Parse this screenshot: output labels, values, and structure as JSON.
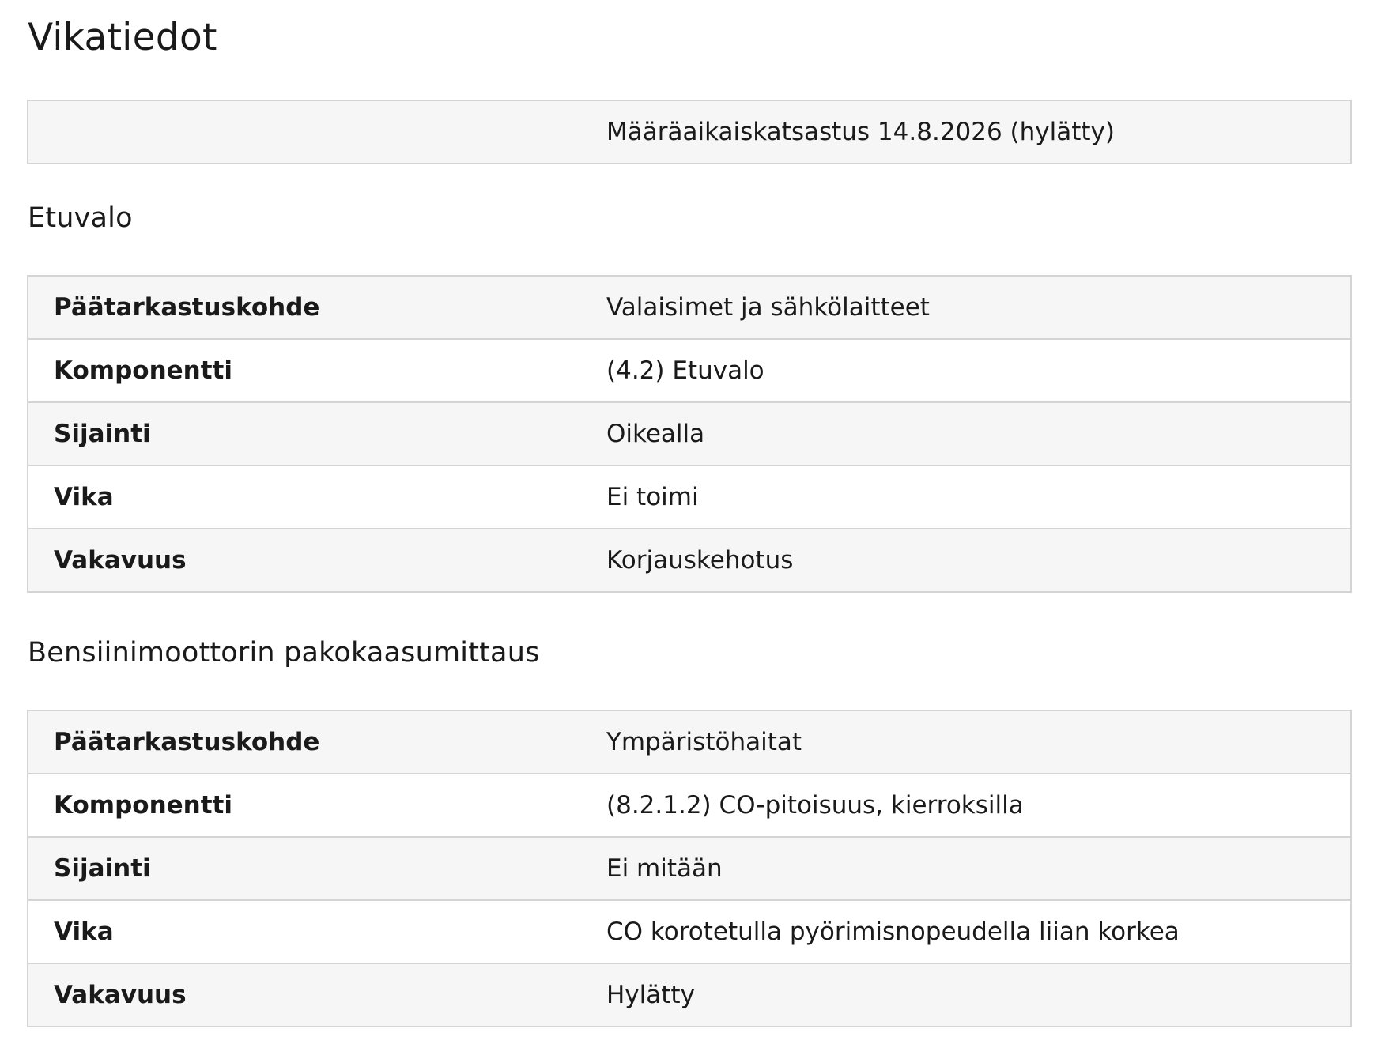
{
  "page_title": "Vikatiedot",
  "summary": {
    "label": "",
    "value": "Määräaikaiskatsastus 14.8.2026 (hylätty)"
  },
  "sections": [
    {
      "title": "Etuvalo",
      "rows": [
        {
          "label": "Päätarkastuskohde",
          "value": "Valaisimet ja sähkölaitteet"
        },
        {
          "label": "Komponentti",
          "value": "(4.2) Etuvalo"
        },
        {
          "label": "Sijainti",
          "value": "Oikealla"
        },
        {
          "label": "Vika",
          "value": "Ei toimi"
        },
        {
          "label": "Vakavuus",
          "value": "Korjauskehotus"
        }
      ]
    },
    {
      "title": "Bensiinimoottorin pakokaasumittaus",
      "rows": [
        {
          "label": "Päätarkastuskohde",
          "value": "Ympäristöhaitat"
        },
        {
          "label": "Komponentti",
          "value": "(8.2.1.2) CO-pitoisuus, kierroksilla"
        },
        {
          "label": "Sijainti",
          "value": "Ei mitään"
        },
        {
          "label": "Vika",
          "value": "CO korotetulla pyörimisnopeudella liian korkea"
        },
        {
          "label": "Vakavuus",
          "value": "Hylätty"
        }
      ]
    }
  ]
}
